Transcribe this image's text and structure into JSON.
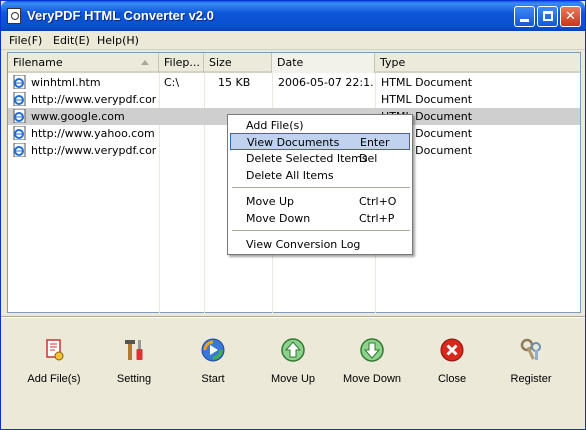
{
  "window": {
    "title": "VeryPDF HTML Converter v2.0"
  },
  "menubar": [
    "File(F)",
    "Edit(E)",
    "Help(H)"
  ],
  "columns": [
    "Filename",
    "Filep...",
    "Size",
    "Date",
    "Type"
  ],
  "rows": [
    {
      "filename": "winhtml.htm",
      "filepath": "C:\\",
      "size": "15 KB",
      "date": "2006-05-07 22:1...",
      "type": "HTML Document"
    },
    {
      "filename": "http://www.verypdf.com",
      "filepath": "",
      "size": "",
      "date": "",
      "type": "HTML Document"
    },
    {
      "filename": "www.google.com",
      "filepath": "",
      "size": "",
      "date": "",
      "type": "HTML Document"
    },
    {
      "filename": "http://www.yahoo.com",
      "filepath": "",
      "size": "",
      "date": "",
      "type": "HTML Document"
    },
    {
      "filename": "http://www.verypdf.com...",
      "filepath": "",
      "size": "",
      "date": "",
      "type": "HTML Document"
    }
  ],
  "context_menu": [
    {
      "label": "Add File(s)",
      "shortcut": ""
    },
    {
      "label": "View Documents",
      "shortcut": "Enter"
    },
    {
      "label": "Delete Selected Items",
      "shortcut": "Del"
    },
    {
      "label": "Delete All Items",
      "shortcut": ""
    },
    {
      "label": "Move Up",
      "shortcut": "Ctrl+O"
    },
    {
      "label": "Move Down",
      "shortcut": "Ctrl+P"
    },
    {
      "label": "View Conversion Log",
      "shortcut": ""
    }
  ],
  "toolbar": [
    {
      "label": "Add File(s)",
      "icon": "add-files-icon"
    },
    {
      "label": "Setting",
      "icon": "tools-icon"
    },
    {
      "label": "Start",
      "icon": "start-icon"
    },
    {
      "label": "Move Up",
      "icon": "arrow-up-icon"
    },
    {
      "label": "Move Down",
      "icon": "arrow-down-icon"
    },
    {
      "label": "Close",
      "icon": "close-icon"
    },
    {
      "label": "Register",
      "icon": "register-icon"
    }
  ],
  "colors": {
    "titlebar": "#0a4fcf",
    "selection": "#cfcfcf",
    "menu_highlight": "#c1d2ee",
    "close_red": "#d8281a",
    "arrow_green": "#2f9a2f"
  }
}
